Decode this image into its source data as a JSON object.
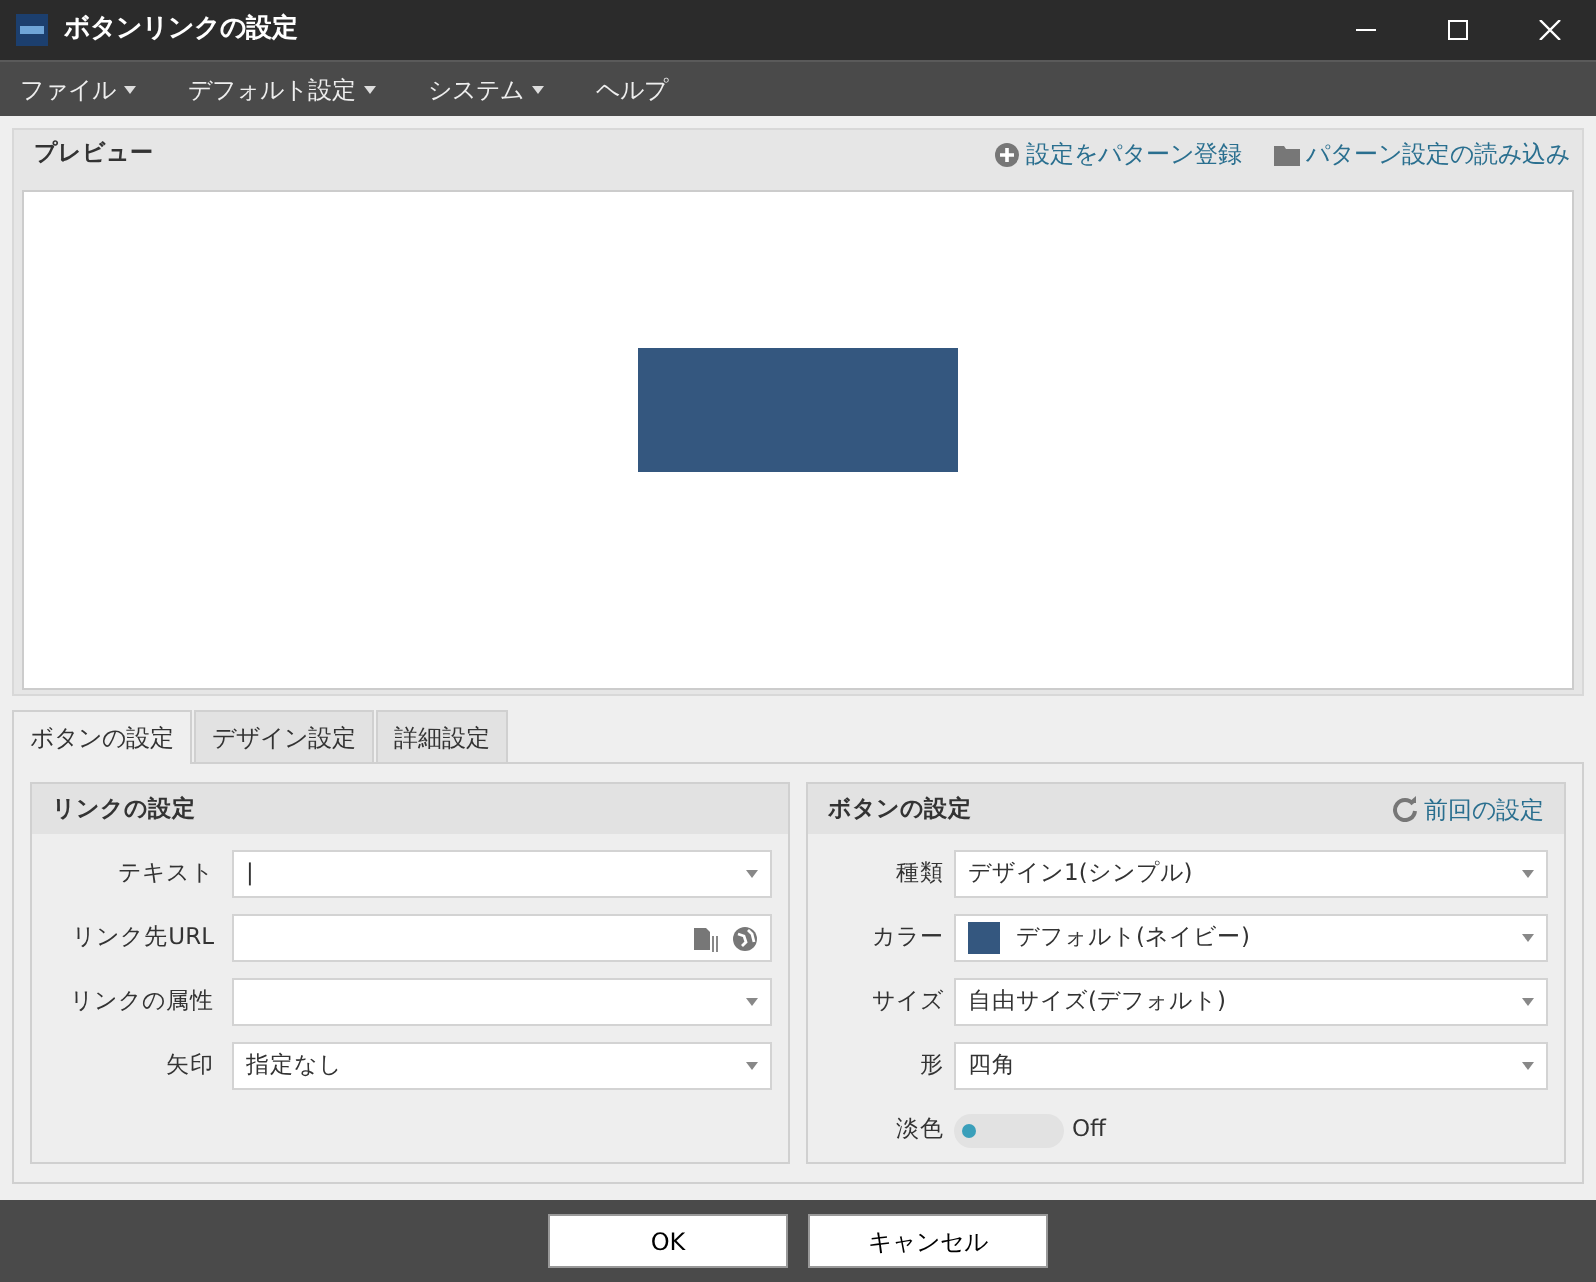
{
  "window": {
    "title": "ボタンリンクの設定"
  },
  "menu": [
    {
      "label": "ファイル",
      "has_dropdown": true
    },
    {
      "label": "デフォルト設定",
      "has_dropdown": true
    },
    {
      "label": "システム",
      "has_dropdown": true
    },
    {
      "label": "ヘルプ",
      "has_dropdown": false
    }
  ],
  "preview": {
    "title": "プレビュー",
    "actions": [
      {
        "kind": "add",
        "label": "設定をパターン登録"
      },
      {
        "kind": "folder",
        "label": "パターン設定の読み込み"
      }
    ]
  },
  "tabs": [
    {
      "label": "ボタンの設定",
      "selected": true
    },
    {
      "label": "デザイン設定",
      "selected": false
    },
    {
      "label": "詳細設定",
      "selected": false
    }
  ],
  "link_panel": {
    "title": "リンクの設定",
    "fields": [
      {
        "kind": "combo",
        "label": "テキスト",
        "value": "|"
      },
      {
        "kind": "url",
        "label": "リンク先URL"
      },
      {
        "kind": "combo",
        "label": "リンクの属性"
      },
      {
        "kind": "combo",
        "label": "矢印",
        "value": "指定なし"
      }
    ]
  },
  "button_panel": {
    "title": "ボタンの設定",
    "action": "前回の設定",
    "fields": [
      {
        "kind": "combo",
        "label": "種類",
        "value": "デザイン1(シンプル)"
      },
      {
        "kind": "color",
        "label": "カラー",
        "value": "デフォルト(ネイビー)",
        "color": "#34577f"
      },
      {
        "kind": "combo",
        "label": "サイズ",
        "value": "自由サイズ(デフォルト)"
      },
      {
        "kind": "combo",
        "label": "形",
        "value": "四角"
      },
      {
        "kind": "toggle",
        "label": "淡色",
        "on": false,
        "state": "Off"
      }
    ]
  },
  "buttons": [
    "OK",
    "キャンセル"
  ]
}
